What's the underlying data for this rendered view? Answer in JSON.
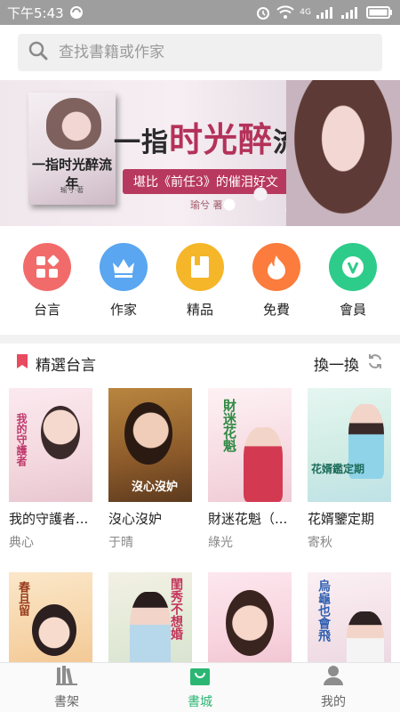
{
  "status_bar": {
    "time": "下午5:43",
    "network": "4G"
  },
  "search": {
    "placeholder": "查找書籍或作家"
  },
  "banner": {
    "headline_prefix": "一指",
    "headline_accent": "时光醉",
    "headline_suffix": "流年",
    "tagline": "堪比《前任3》的催泪好文",
    "author": "瑜兮 著",
    "cover_title": "一指时光醉流年",
    "cover_author": "瑜兮·著"
  },
  "categories": [
    {
      "label": "台言",
      "icon": "grid-icon",
      "color": "#f26b6b"
    },
    {
      "label": "作家",
      "icon": "crown-icon",
      "color": "#5aa6f0"
    },
    {
      "label": "精品",
      "icon": "book-icon",
      "color": "#f5b629"
    },
    {
      "label": "免費",
      "icon": "fire-icon",
      "color": "#fb7c3c"
    },
    {
      "label": "會員",
      "icon": "vip-icon",
      "color": "#2ecc8a"
    }
  ],
  "section": {
    "title": "精選台言",
    "refresh_label": "換一換"
  },
  "books": [
    {
      "title": "我的守護者...",
      "author": "典心",
      "cover_text": "我的守護者"
    },
    {
      "title": "沒心沒妒",
      "author": "于晴",
      "cover_text": "沒心沒妒"
    },
    {
      "title": "財迷花魁（...",
      "author": "綠光",
      "cover_text": "財迷花魁"
    },
    {
      "title": "花婿鑒定期",
      "author": "寄秋",
      "cover_text": "花婿鑑定期"
    }
  ],
  "books_row2": [
    {
      "cover_text": "春且留"
    },
    {
      "cover_text": ""
    },
    {
      "cover_text": "閨秀不想婚"
    },
    {
      "cover_text": ""
    },
    {
      "cover_text": "烏龜也會飛"
    }
  ],
  "tabs": [
    {
      "label": "書架",
      "icon": "bookshelf-icon",
      "active": false
    },
    {
      "label": "書城",
      "icon": "store-bag-icon",
      "active": true
    },
    {
      "label": "我的",
      "icon": "profile-icon",
      "active": false
    }
  ],
  "colors": {
    "accent": "#2bb673",
    "section_mark": "#e84a5f",
    "statusbar": "#9e9e9e"
  }
}
